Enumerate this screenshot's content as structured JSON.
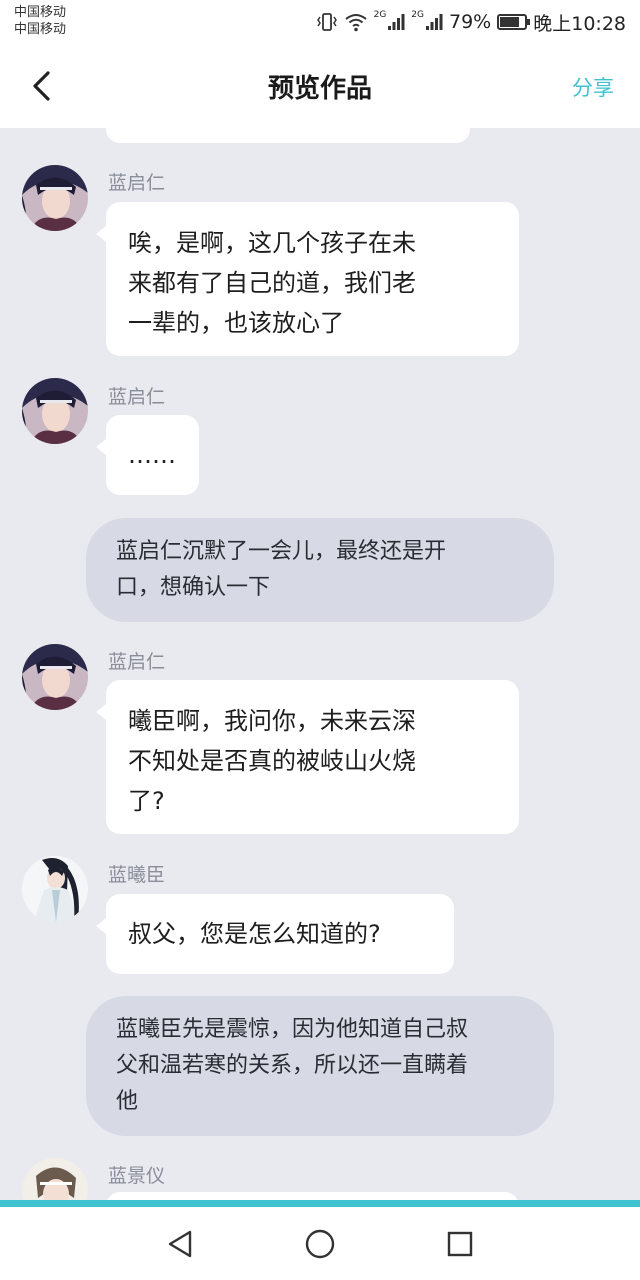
{
  "status_bar": {
    "carrier_1": "中国移动",
    "carrier_2": "中国移动",
    "network_1": "2G",
    "network_2": "2G",
    "battery_text": "79%",
    "battery_level": 0.79,
    "time": "晚上10:28"
  },
  "nav": {
    "title": "预览作品",
    "share_label": "分享"
  },
  "messages": [
    {
      "sender": "蓝启仁",
      "text_lines": [
        "唉，是啊，这几个孩子在未",
        "来都有了自己的道，我们老",
        "一辈的，也该放心了"
      ]
    },
    {
      "sender": "蓝启仁",
      "text_lines": [
        "……"
      ]
    },
    {
      "narration_lines": [
        "蓝启仁沉默了一会儿，最终还是开",
        "口，想确认一下"
      ]
    },
    {
      "sender": "蓝启仁",
      "text_lines": [
        "曦臣啊，我问你，未来云深",
        "不知处是否真的被岐山火烧",
        "了?"
      ]
    },
    {
      "sender": "蓝曦臣",
      "text_lines": [
        "叔父，您是怎么知道的?"
      ]
    },
    {
      "narration_lines": [
        "蓝曦臣先是震惊，因为他知道自己叔",
        "父和温若寒的关系，所以还一直瞒着",
        "他"
      ]
    },
    {
      "sender": "蓝景仪"
    }
  ],
  "colors": {
    "accent": "#3fc2cf",
    "chat_background": "#e9eaf0",
    "narration_background": "#d7dae4"
  }
}
